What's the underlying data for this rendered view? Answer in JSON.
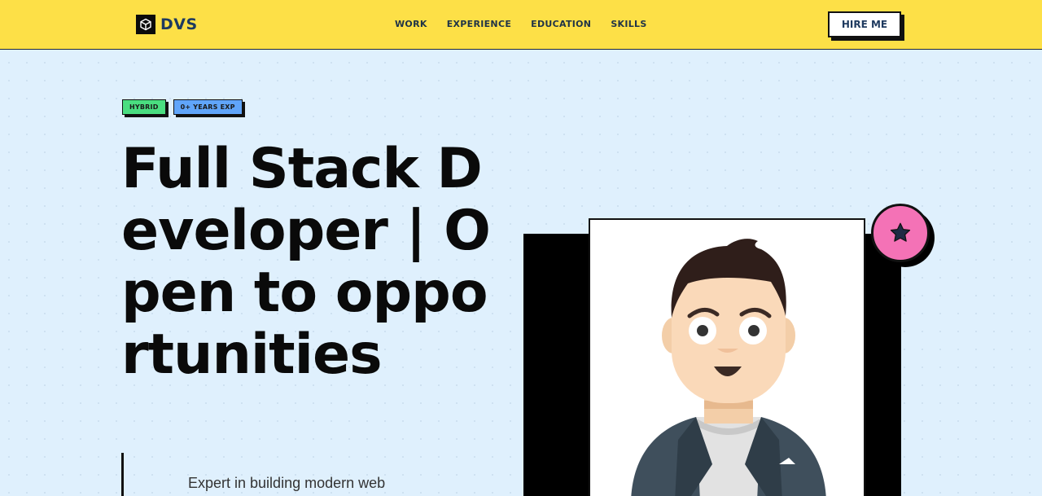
{
  "brand": {
    "name": "DVS",
    "icon": "cube-icon"
  },
  "nav": {
    "items": [
      {
        "label": "WORK"
      },
      {
        "label": "EXPERIENCE"
      },
      {
        "label": "EDUCATION"
      },
      {
        "label": "SKILLS"
      }
    ]
  },
  "header": {
    "cta_label": "HIRE ME"
  },
  "hero": {
    "badges": [
      {
        "label": "HYBRID",
        "color": "#4ade80"
      },
      {
        "label": "0+ YEARS EXP",
        "color": "#60a5fa"
      }
    ],
    "title": "Full Stack Developer | Open to opportunities",
    "description": "Expert in building modern web"
  },
  "avatar": {
    "star_icon": "star-icon",
    "accent_color": "#f472b6"
  },
  "colors": {
    "navbar": "#fde047",
    "background": "#dff0fd"
  }
}
